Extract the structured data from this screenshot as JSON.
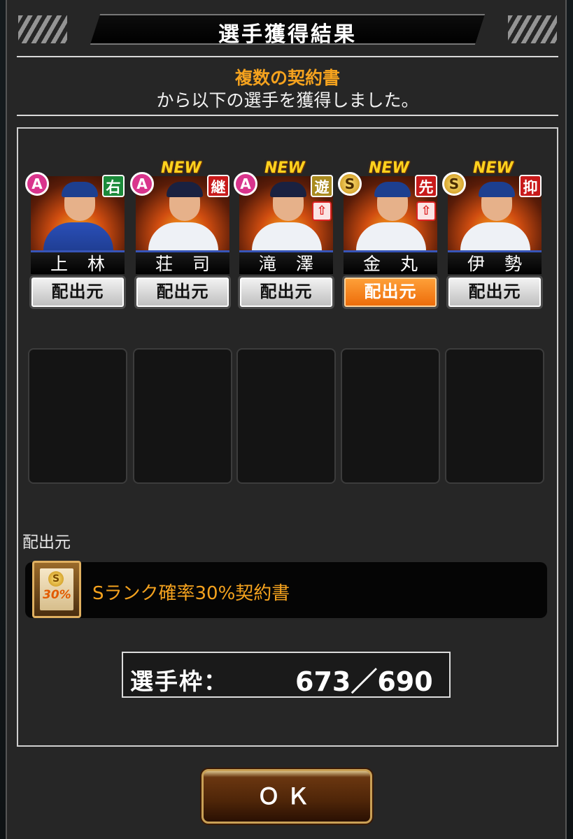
{
  "dialog": {
    "title": "選手獲得結果",
    "message_highlight": "複数の契約書",
    "message_rest": "から以下の選手を獲得しました。"
  },
  "cards": [
    {
      "name": "上 林",
      "rank": "A",
      "position": "右",
      "position_color": "#1b8a3a",
      "is_new": false,
      "new_label": "",
      "upgrade": false,
      "origin_label": "配出元",
      "origin_selected": false
    },
    {
      "name": "荘 司",
      "rank": "A",
      "position": "継",
      "position_color": "#c81a1a",
      "is_new": true,
      "new_label": "NEW",
      "upgrade": false,
      "origin_label": "配出元",
      "origin_selected": false
    },
    {
      "name": "滝 澤",
      "rank": "A",
      "position": "遊",
      "position_color": "#a98a1f",
      "is_new": true,
      "new_label": "NEW",
      "upgrade": true,
      "origin_label": "配出元",
      "origin_selected": false
    },
    {
      "name": "金 丸",
      "rank": "S",
      "position": "先",
      "position_color": "#c81a1a",
      "is_new": true,
      "new_label": "NEW",
      "upgrade": true,
      "origin_label": "配出元",
      "origin_selected": true
    },
    {
      "name": "伊 勢",
      "rank": "S",
      "position": "抑",
      "position_color": "#c81a1a",
      "is_new": true,
      "new_label": "NEW",
      "upgrade": false,
      "origin_label": "配出元",
      "origin_selected": false
    }
  ],
  "empty_slots": 5,
  "source": {
    "section_label": "配出元",
    "contract_name": "Sランク確率30%契約書",
    "ticket_badge": "30%",
    "ticket_coin": "S"
  },
  "capacity": {
    "label": "選手枠：",
    "value": "673／690"
  },
  "ok_button": "ＯＫ",
  "upgrade_glyph": "⇧",
  "colors": {
    "accent_orange": "#f4a21e",
    "selected_button": "#ec6a08",
    "rank_A": "#d9348c",
    "rank_S": "#c58c0f"
  }
}
